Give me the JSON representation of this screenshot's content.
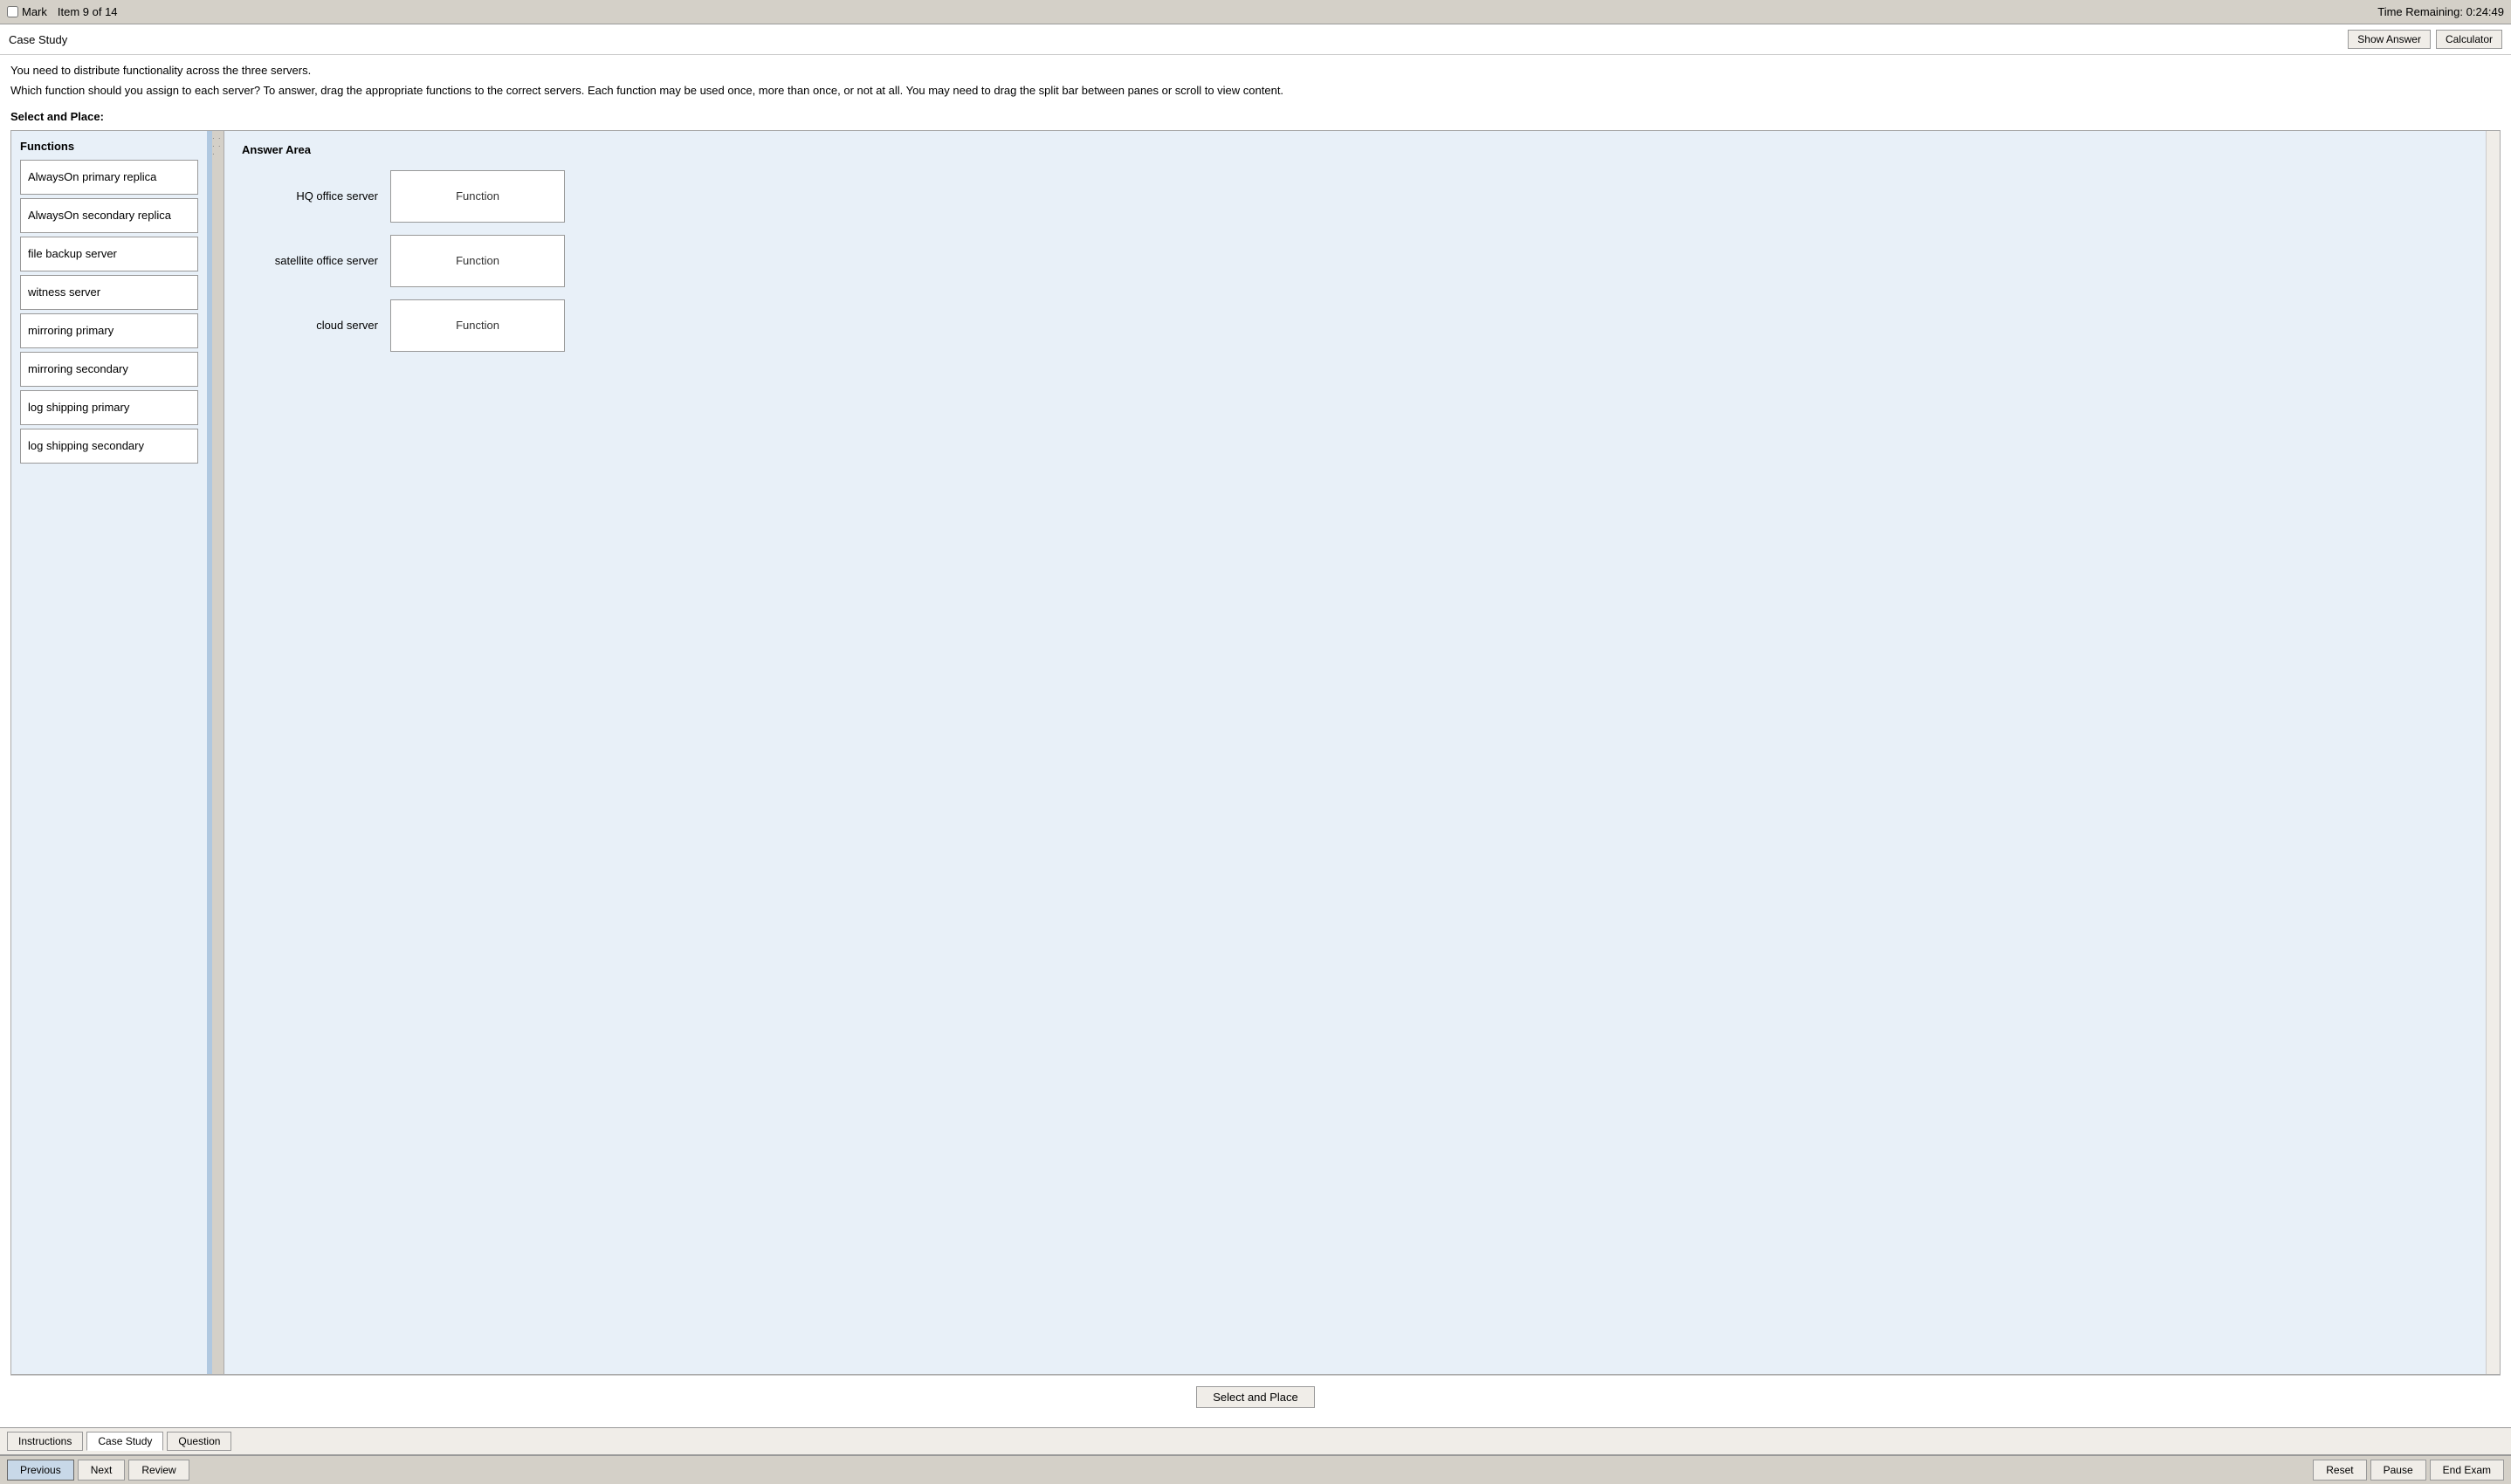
{
  "topBar": {
    "markLabel": "Mark",
    "itemInfo": "Item 9 of 14",
    "timeLabel": "Time Remaining: 0:24:49"
  },
  "header": {
    "title": "Case Study",
    "showAnswerLabel": "Show Answer",
    "calculatorLabel": "Calculator"
  },
  "instructions": {
    "line1": "You need to distribute functionality across the three servers.",
    "line2": "Which function should you assign to each server? To answer, drag the appropriate functions to the correct servers. Each function may be used once, more than once, or not at all. You may need to drag the split bar between panes or scroll to view content."
  },
  "selectPlaceLabel": "Select and Place:",
  "functionsPanel": {
    "title": "Functions",
    "items": [
      {
        "id": "f1",
        "label": "AlwaysOn primary replica"
      },
      {
        "id": "f2",
        "label": "AlwaysOn secondary replica"
      },
      {
        "id": "f3",
        "label": "file backup server"
      },
      {
        "id": "f4",
        "label": "witness server"
      },
      {
        "id": "f5",
        "label": "mirroring primary"
      },
      {
        "id": "f6",
        "label": "mirroring secondary"
      },
      {
        "id": "f7",
        "label": "log shipping primary"
      },
      {
        "id": "f8",
        "label": "log shipping secondary"
      }
    ]
  },
  "answerPanel": {
    "title": "Answer Area",
    "rows": [
      {
        "serverLabel": "HQ office server",
        "placeholder": "Function"
      },
      {
        "serverLabel": "satellite office server",
        "placeholder": "Function"
      },
      {
        "serverLabel": "cloud server",
        "placeholder": "Function"
      }
    ]
  },
  "selectPlaceButton": "Select and Place",
  "tabs": {
    "items": [
      {
        "label": "Instructions",
        "active": false
      },
      {
        "label": "Case Study",
        "active": true
      },
      {
        "label": "Question",
        "active": false
      }
    ]
  },
  "navButtons": {
    "previous": "Previous",
    "next": "Next",
    "review": "Review",
    "reset": "Reset",
    "pause": "Pause",
    "endExam": "End Exam"
  }
}
